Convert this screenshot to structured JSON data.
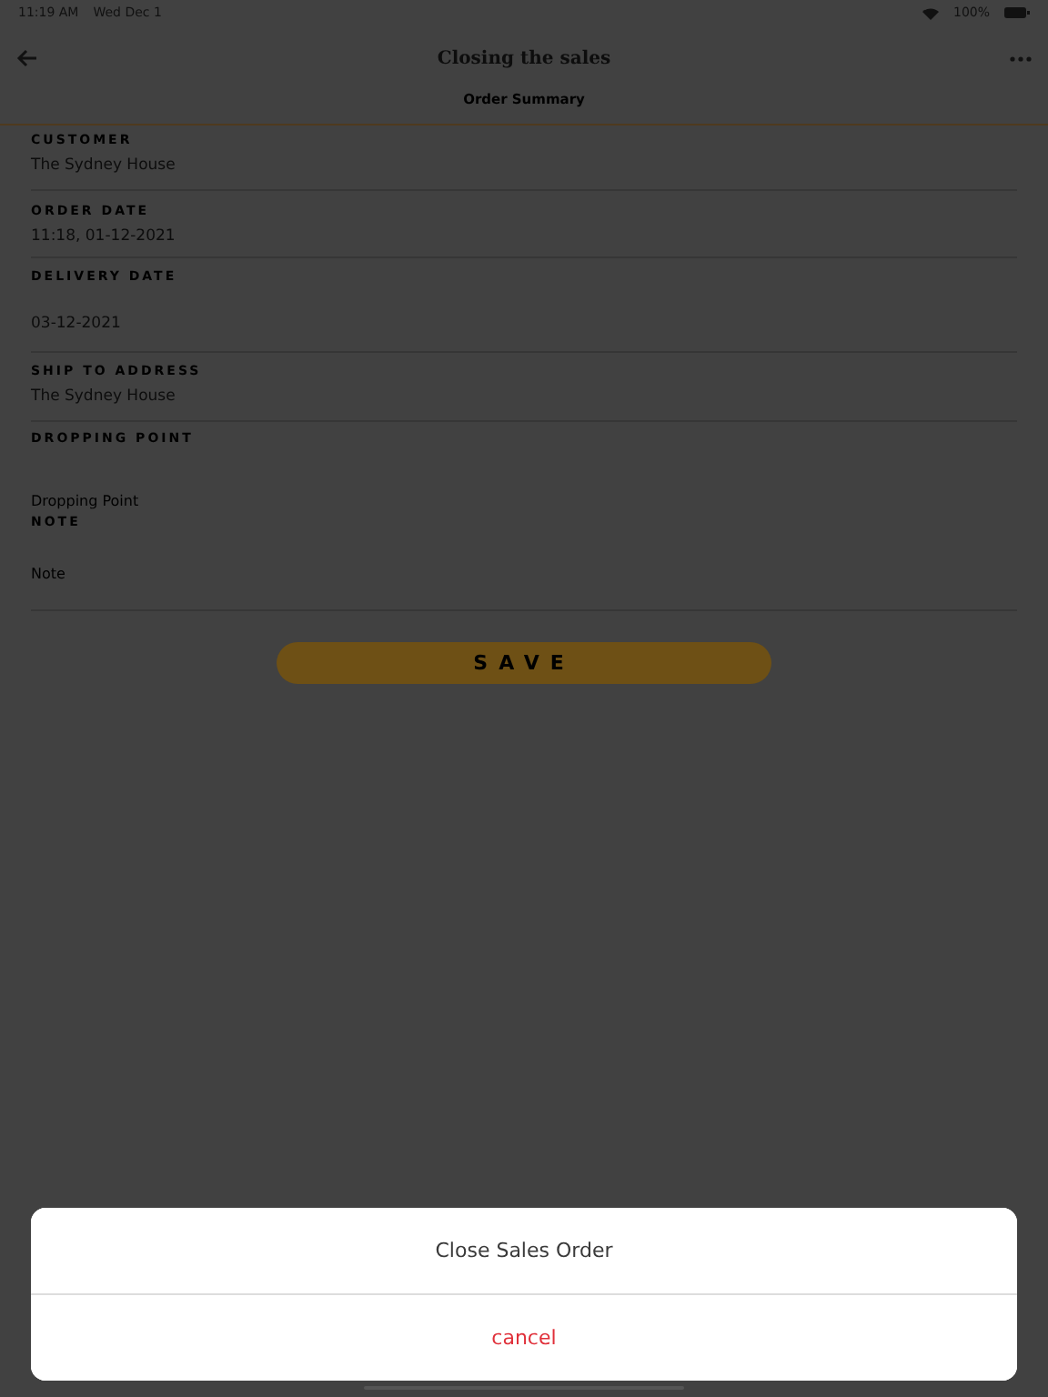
{
  "status_bar": {
    "time": "11:19 AM",
    "date": "Wed Dec 1",
    "battery": "100%"
  },
  "header": {
    "title": "Closing the sales",
    "subtitle": "Order Summary"
  },
  "fields": [
    {
      "kind": "value",
      "label": "CUSTOMER",
      "value": "The Sydney House"
    },
    {
      "kind": "value",
      "label": "ORDER DATE",
      "value": "11:18, 01-12-2021"
    },
    {
      "kind": "date",
      "label": "DELIVERY DATE",
      "value": "03-12-2021"
    },
    {
      "kind": "value",
      "label": "SHIP TO ADDRESS",
      "value": "The Sydney House"
    },
    {
      "kind": "input",
      "label": "DROPPING POINT",
      "placeholder": "Dropping Point"
    },
    {
      "kind": "input",
      "label": "NOTE",
      "placeholder": "Note"
    }
  ],
  "save_button": "SAVE",
  "action_sheet": {
    "actions": [
      {
        "label": "Close Sales Order",
        "kind": "default"
      },
      {
        "label": "cancel",
        "kind": "destructive"
      }
    ]
  }
}
